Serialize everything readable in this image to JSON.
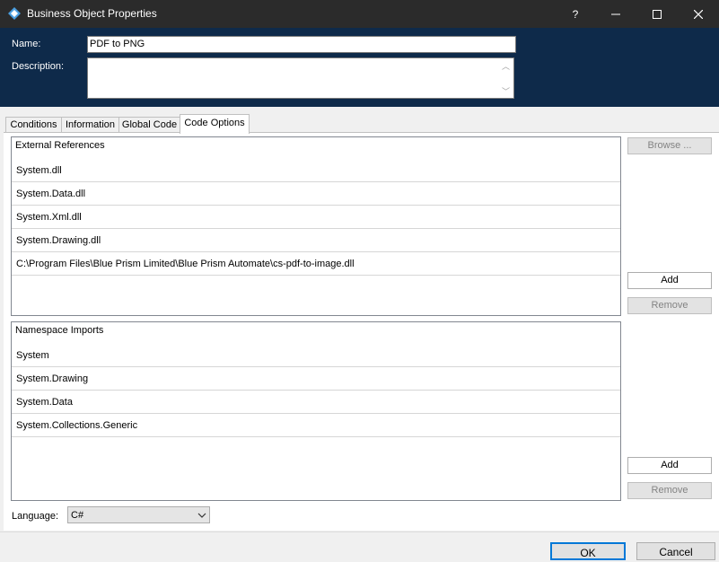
{
  "window": {
    "title": "Business Object Properties",
    "help_glyph": "?",
    "minimize_glyph": "—",
    "maximize_glyph": "☐",
    "close_glyph": "✕",
    "app_icon": "blue-prism-object-icon"
  },
  "header": {
    "name_label": "Name:",
    "name_value": "PDF to PNG",
    "description_label": "Description:",
    "description_value": ""
  },
  "tabs": [
    {
      "label": "Conditions",
      "active": false
    },
    {
      "label": "Information",
      "active": false
    },
    {
      "label": "Global Code",
      "active": false
    },
    {
      "label": "Code Options",
      "active": true
    }
  ],
  "external_references": {
    "header": "External References",
    "items": [
      "System.dll",
      "System.Data.dll",
      "System.Xml.dll",
      "System.Drawing.dll",
      "C:\\Program Files\\Blue Prism Limited\\Blue Prism Automate\\cs-pdf-to-image.dll"
    ],
    "browse_label": "Browse ...",
    "add_label": "Add",
    "remove_label": "Remove"
  },
  "namespace_imports": {
    "header": "Namespace Imports",
    "items": [
      "System",
      "System.Drawing",
      "System.Data",
      "System.Collections.Generic"
    ],
    "add_label": "Add",
    "remove_label": "Remove"
  },
  "language": {
    "label": "Language:",
    "selected": "C#"
  },
  "footer": {
    "ok_label": "OK",
    "cancel_label": "Cancel"
  },
  "colors": {
    "titlebar": "#2b2b2b",
    "header_band": "#0e2a4a",
    "accent": "#0078d7"
  }
}
